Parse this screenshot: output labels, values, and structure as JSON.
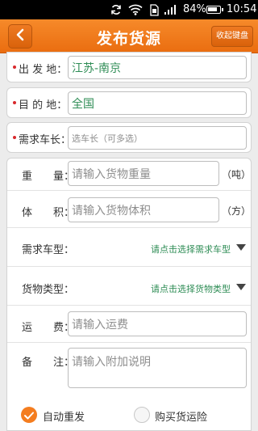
{
  "status_bar": {
    "battery_percent": "84%",
    "battery_level": 0.84,
    "time": "10:54",
    "icons": [
      "sync-icon",
      "wifi-icon",
      "sim-icon",
      "signal-icon",
      "battery-icon"
    ]
  },
  "header": {
    "back_icon": "chevron-left-icon",
    "title": "发布货源",
    "keyboard_button": "收起键盘"
  },
  "route": {
    "origin_label": "出 发 地：",
    "origin_value": "江苏-南京",
    "dest_label": "目 的 地：",
    "dest_value": "全国"
  },
  "truck_length": {
    "label": "需求车长：",
    "placeholder": "选车长（可多选）"
  },
  "details": {
    "weight_label": "重　　量：",
    "weight_placeholder": "请输入货物重量",
    "weight_unit": "（吨）",
    "volume_label": "体　　积：",
    "volume_placeholder": "请输入货物体积",
    "volume_unit": "（方）",
    "truck_type_label": "需求车型：",
    "truck_type_value": "请点击选择需求车型",
    "cargo_type_label": "货物类型：",
    "cargo_type_value": "请点击选择货物类型",
    "freight_label": "运　　费：",
    "freight_placeholder": "请输入运费",
    "remark_label": "备　　注：",
    "remark_placeholder": "请输入附加说明"
  },
  "options": {
    "auto_resend_label": "自动重发",
    "auto_resend_checked": true,
    "insurance_label": "购买货运险",
    "insurance_checked": false
  },
  "colors": {
    "accent": "#f47d1f",
    "value_green": "#2f8d56",
    "required_red": "#d8282c"
  }
}
